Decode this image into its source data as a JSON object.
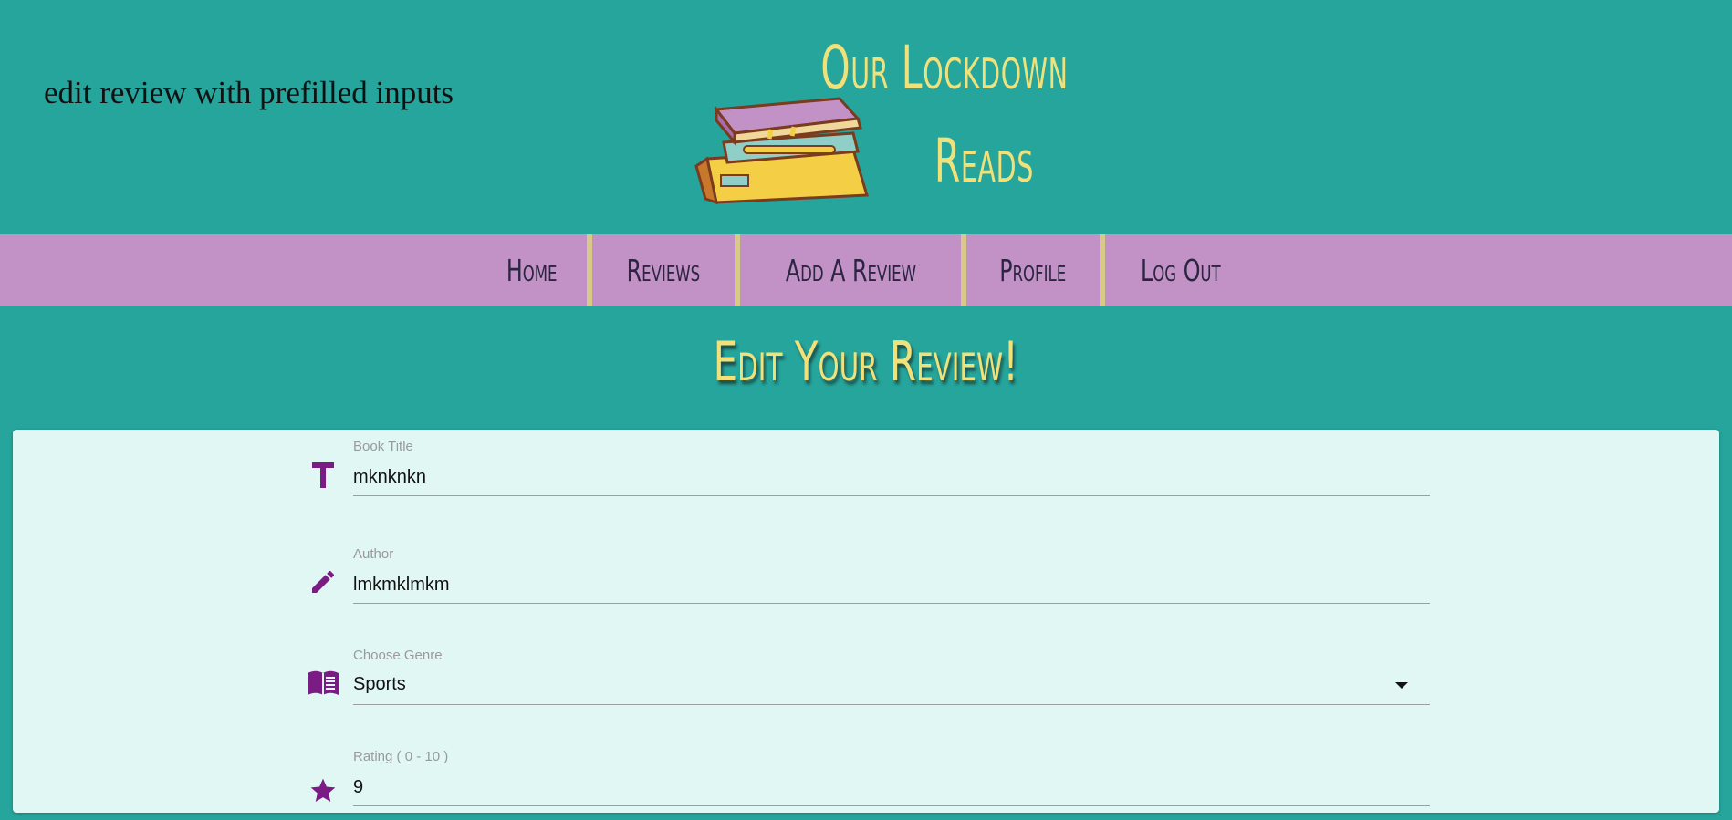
{
  "caption": "edit review with prefilled inputs",
  "brand": {
    "title_line1": "Our Lockdown",
    "title_line2": "Reads"
  },
  "nav": {
    "items": [
      {
        "label": "Home"
      },
      {
        "label": "Reviews"
      },
      {
        "label": "Add A Review"
      },
      {
        "label": "Profile"
      },
      {
        "label": "Log Out"
      }
    ]
  },
  "page": {
    "heading": "Edit Your Review!"
  },
  "form": {
    "title": {
      "label": "Book Title",
      "value": "mknknkn",
      "icon": "title-icon"
    },
    "author": {
      "label": "Author",
      "value": "lmkmklmkm",
      "icon": "pencil-icon"
    },
    "genre": {
      "label": "Choose Genre",
      "value": "Sports",
      "icon": "book-icon"
    },
    "rating": {
      "label": "Rating ( 0 - 10 )",
      "value": "9",
      "icon": "star-icon"
    }
  },
  "colors": {
    "background": "#25a59c",
    "nav": "#c292c7",
    "accent_yellow": "#f0e17a",
    "icon_purple": "#7b1c85",
    "card": "#e0f7f4"
  }
}
